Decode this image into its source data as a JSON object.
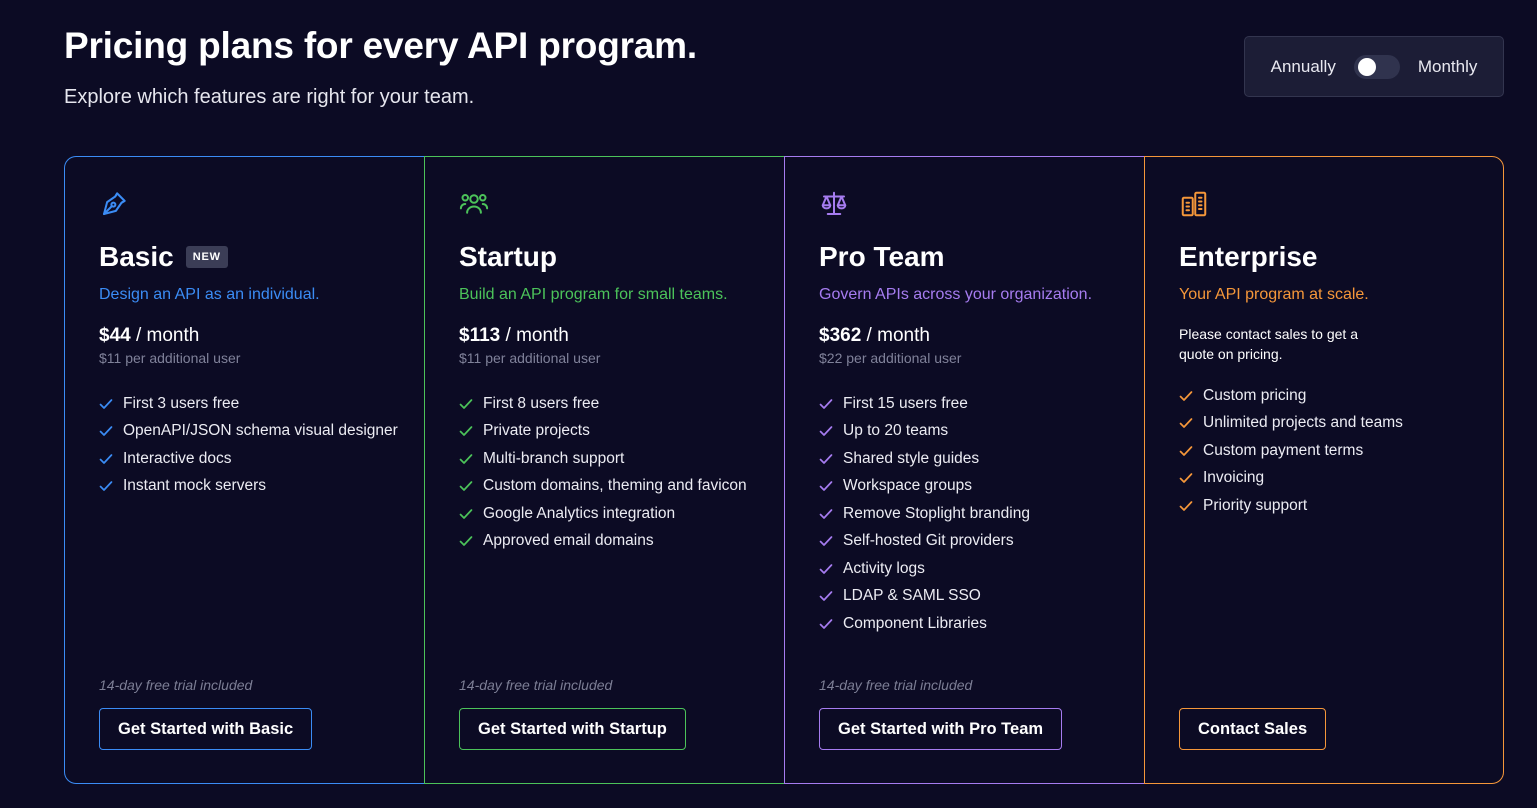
{
  "header": {
    "title": "Pricing plans for every API program.",
    "subtitle": "Explore which features are right for your team."
  },
  "billing_toggle": {
    "left_label": "Annually",
    "right_label": "Monthly"
  },
  "plans": [
    {
      "name": "Basic",
      "badge": "NEW",
      "icon": "pen-nib-icon",
      "accent": "#3b8cf5",
      "tagline": "Design an API as an individual.",
      "price": "$44",
      "period": " / month",
      "extra": "$11 per additional user",
      "features": [
        "First 3 users free",
        "OpenAPI/JSON schema visual designer",
        "Interactive docs",
        "Instant mock servers"
      ],
      "trial": "14-day free trial included",
      "cta": "Get Started with Basic"
    },
    {
      "name": "Startup",
      "icon": "users-icon",
      "accent": "#4cc35a",
      "tagline": "Build an API program for small teams.",
      "price": "$113",
      "period": " / month",
      "extra": "$11 per additional user",
      "features": [
        "First 8 users free",
        "Private projects",
        "Multi-branch support",
        "Custom domains, theming and favicon",
        "Google Analytics integration",
        "Approved email domains"
      ],
      "trial": "14-day free trial included",
      "cta": "Get Started with Startup"
    },
    {
      "name": "Pro Team",
      "icon": "balance-scale-icon",
      "accent": "#a67cf0",
      "tagline": "Govern APIs across your organization.",
      "price": "$362",
      "period": " / month",
      "extra": "$22 per additional user",
      "features": [
        "First 15 users free",
        "Up to 20 teams",
        "Shared style guides",
        "Workspace groups",
        "Remove Stoplight branding",
        "Self-hosted Git providers",
        "Activity logs",
        "LDAP & SAML SSO",
        "Component Libraries"
      ],
      "trial": "14-day free trial included",
      "cta": "Get Started with Pro Team"
    },
    {
      "name": "Enterprise",
      "icon": "building-icon",
      "accent": "#f5973a",
      "tagline": "Your API program at scale.",
      "contact": "Please contact sales to get a quote on pricing.",
      "features": [
        "Custom pricing",
        "Unlimited projects and teams",
        "Custom payment terms",
        "Invoicing",
        "Priority support"
      ],
      "cta": "Contact Sales"
    }
  ]
}
